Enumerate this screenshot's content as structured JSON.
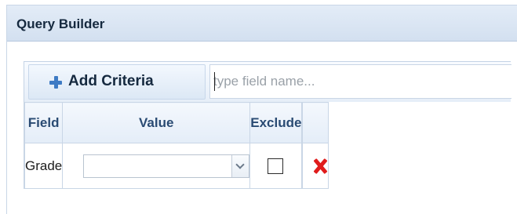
{
  "panel": {
    "title": "Query Builder"
  },
  "toolbar": {
    "add_criteria_label": "Add Criteria",
    "field_input_placeholder": "type field name..."
  },
  "grid": {
    "columns": [
      "Field",
      "Value",
      "Exclude"
    ],
    "rows": [
      {
        "field": "Grade",
        "value": "",
        "exclude": false
      }
    ]
  },
  "icons": {
    "add": "plus-icon",
    "dropdown": "chevron-down-icon",
    "delete": "delete-x-icon"
  },
  "colors": {
    "accent": "#3e7bc4",
    "delete": "#e01c1c",
    "header_text": "#2a4b73"
  }
}
